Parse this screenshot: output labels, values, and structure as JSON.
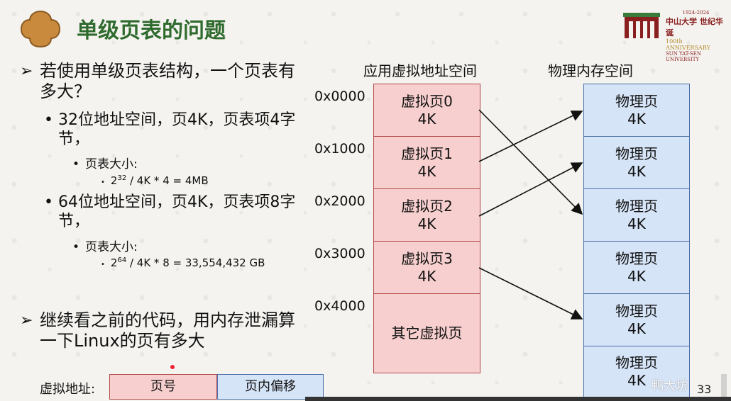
{
  "slide": {
    "title": "单级页表的问题",
    "logo": {
      "years": "1924-2024",
      "name": "中山大学 世纪华诞",
      "anniv": "100th ANNIVERSARY",
      "univ": "SUN YAT-SEN UNIVERSITY"
    },
    "bullets": {
      "q1": "若使用单级页表结构，一个页表有多大？",
      "sub_a": "32位地址空间，页4K，页表项4字节，",
      "sub_a_size_label": "页表大小:",
      "sub_a_calc_base": "2",
      "sub_a_calc_exp": "32",
      "sub_a_calc_rest": " / 4K * 4 = 4MB",
      "sub_b": "64位地址空间，页4K，页表项8字节，",
      "sub_b_size_label": "页表大小:",
      "sub_b_calc_base": "2",
      "sub_b_calc_exp": "64",
      "sub_b_calc_rest": " / 4K * 8 = 33,554,432 GB",
      "q2": "继续看之前的代码，用内存泄漏算一下Linux的页有多大"
    },
    "bullet_symbols": {
      "arrow": "➢",
      "dot": "•",
      "small_dot": "•"
    },
    "vaddr": {
      "label": "虚拟地址:",
      "page_no": "页号",
      "page_offset": "页内偏移"
    },
    "diagram": {
      "virtual_header": "应用虚拟地址空间",
      "physical_header": "物理内存空间",
      "addresses": [
        "0x0000",
        "0x1000",
        "0x2000",
        "0x3000",
        "0x4000"
      ],
      "virtual_pages": [
        {
          "name": "虚拟页0",
          "size": "4K"
        },
        {
          "name": "虚拟页1",
          "size": "4K"
        },
        {
          "name": "虚拟页2",
          "size": "4K"
        },
        {
          "name": "虚拟页3",
          "size": "4K"
        },
        {
          "name": "其它虚拟页",
          "size": ""
        }
      ],
      "physical_pages": [
        {
          "name": "物理页",
          "size": "4K"
        },
        {
          "name": "物理页",
          "size": "4K"
        },
        {
          "name": "物理页",
          "size": "4K"
        },
        {
          "name": "物理页",
          "size": "4K"
        },
        {
          "name": "物理页",
          "size": "4K"
        },
        {
          "name": "物理页",
          "size": "4K"
        }
      ]
    },
    "watermark": "鸭大坊",
    "page_number": "33",
    "colors": {
      "title": "#2f6b2e",
      "virtual_fill": "#f7cfcf",
      "physical_fill": "#d6e4f7"
    }
  }
}
